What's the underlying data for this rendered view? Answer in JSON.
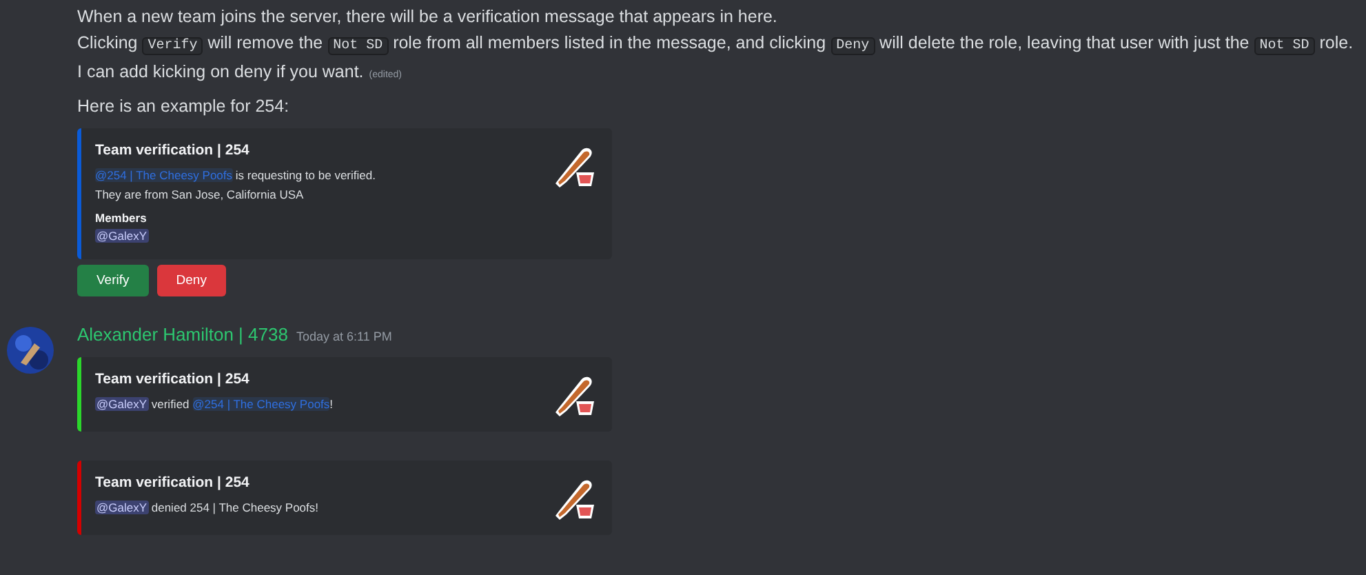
{
  "messages": [
    {
      "lines": [
        [
          {
            "kind": "text",
            "text": "When a new team joins the server, there will be a verification message that appears in here."
          }
        ],
        [
          {
            "kind": "text",
            "text": "Clicking "
          },
          {
            "kind": "code",
            "text": "Verify"
          },
          {
            "kind": "text",
            "text": " will remove the "
          },
          {
            "kind": "code",
            "text": "Not SD"
          },
          {
            "kind": "text",
            "text": " role from all members listed in the message, and clicking "
          },
          {
            "kind": "code",
            "text": "Deny"
          },
          {
            "kind": "text",
            "text": " will delete the role, leaving that user with just the "
          },
          {
            "kind": "code",
            "text": "Not SD"
          },
          {
            "kind": "text",
            "text": " role."
          }
        ],
        [
          {
            "kind": "text",
            "text": "I can add kicking on deny if you want."
          },
          {
            "kind": "edited",
            "text": "(edited)"
          }
        ],
        [
          {
            "kind": "text",
            "text": "Here is an example for 254:"
          }
        ]
      ],
      "embeds": [
        {
          "color": "#0a5bd8",
          "title": "Team verification | 254",
          "description": [
            [
              {
                "kind": "role",
                "text": "@254 | The Cheesy Poofs"
              },
              {
                "kind": "text",
                "text": " is requesting to be verified."
              }
            ],
            [
              {
                "kind": "text",
                "text": "They are from San Jose, California USA"
              }
            ]
          ],
          "fields": [
            {
              "name": "Members",
              "value": [
                {
                  "kind": "user",
                  "text": "@GalexY"
                }
              ]
            }
          ]
        }
      ],
      "buttons": [
        {
          "kind": "success",
          "label": "Verify"
        },
        {
          "kind": "danger",
          "label": "Deny"
        }
      ]
    },
    {
      "author": {
        "name": "Alexander Hamilton | 4738",
        "timestamp": "Today at 6:11 PM"
      },
      "embeds": [
        {
          "color": "#2bd62b",
          "title": "Team verification | 254",
          "description": [
            [
              {
                "kind": "user",
                "text": "@GalexY"
              },
              {
                "kind": "text",
                "text": " verified "
              },
              {
                "kind": "role",
                "text": "@254 | The Cheesy Poofs"
              },
              {
                "kind": "text",
                "text": "!"
              }
            ]
          ]
        },
        {
          "color": "#d40000",
          "title": "Team verification | 254",
          "description": [
            [
              {
                "kind": "user",
                "text": "@GalexY"
              },
              {
                "kind": "text",
                "text": " denied 254 | The Cheesy Poofs!"
              }
            ]
          ]
        }
      ]
    }
  ]
}
